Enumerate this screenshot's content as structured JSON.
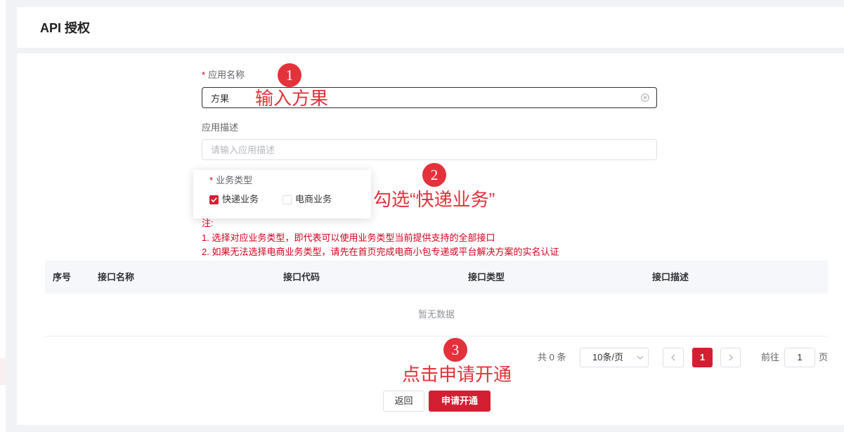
{
  "header": {
    "title": "API 授权"
  },
  "form": {
    "app_name": {
      "required_mark": "*",
      "label": "应用名称",
      "value": "方果"
    },
    "app_desc": {
      "label": "应用描述",
      "placeholder": "请输入应用描述"
    },
    "business_type": {
      "required_mark": "*",
      "label": "业务类型",
      "options": [
        {
          "label": "快递业务",
          "checked": true
        },
        {
          "label": "电商业务",
          "checked": false
        }
      ]
    },
    "notes": {
      "title": "注:",
      "items": [
        "1. 选择对应业务类型，即代表可以使用业务类型当前提供支持的全部接口",
        "2. 如果无法选择电商业务类型，请先在首页完成电商小包专递或平台解决方案的实名认证"
      ]
    }
  },
  "table": {
    "columns": [
      "序号",
      "接口名称",
      "接口代码",
      "接口类型",
      "接口描述"
    ],
    "empty_text": "暂无数据"
  },
  "pagination": {
    "total_text": "共 0 条",
    "page_size": "10条/页",
    "current_page": "1",
    "goto_label": "前往",
    "goto_value": "1",
    "page_suffix": "页"
  },
  "actions": {
    "back_label": "返回",
    "apply_label": "申请开通"
  },
  "annotations": [
    {
      "number": "1",
      "text": "输入方果"
    },
    {
      "number": "2",
      "text": "勾选“快递业务”"
    },
    {
      "number": "3",
      "text": "点击申请开通"
    }
  ],
  "icons": {
    "clear": "circle-x-icon",
    "checkbox_tick": "check-icon",
    "select": "chevron-down-icon",
    "prev": "chevron-left-icon",
    "next": "chevron-right-icon"
  },
  "colors": {
    "primary": "#d41f33",
    "annotation": "#e3323b",
    "note": "#d0021b"
  }
}
